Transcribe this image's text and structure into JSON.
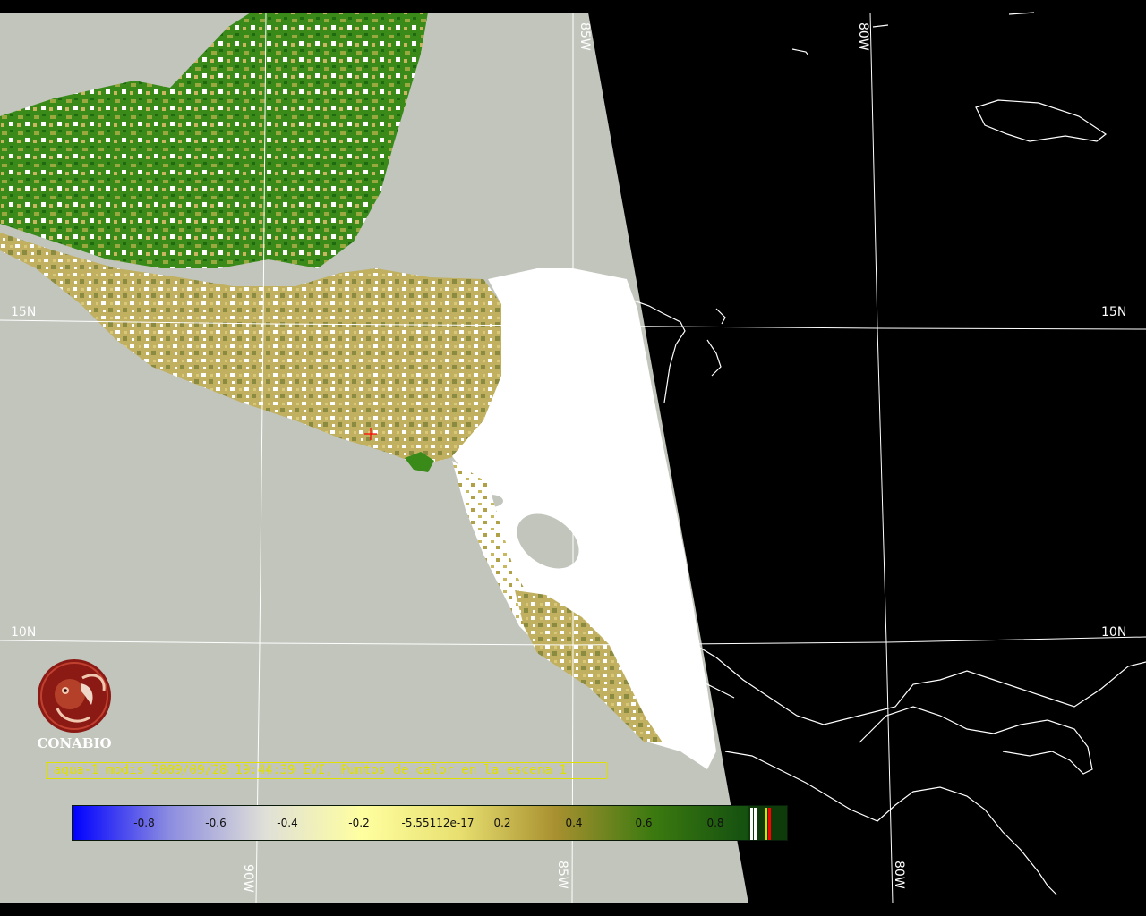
{
  "map": {
    "product_label": "aqua-1 modis 2009/09/28 19:44:39 EVI, Puntos de calor en la escena 1",
    "logo_text": "CONABIO",
    "grid_labels": {
      "lat_15n_left": "15N",
      "lat_15n_right": "15N",
      "lat_10n_left": "10N",
      "lat_10n_right": "10N",
      "lon_85w_top": "85W",
      "lon_80w_top": "80W",
      "lon_90w_bottom": "90W",
      "lon_85w_bottom": "85W",
      "lon_80w_bottom": "80W"
    },
    "colors": {
      "land_background": "#c1c5bc",
      "ocean_night": "#000000",
      "cloud": "#ffffff",
      "vegetation_dense": "#2a7a12",
      "vegetation_sparse": "#b8a040",
      "grid": "#ffffff",
      "label_text": "#e0e000"
    }
  },
  "colorbar": {
    "ticks": [
      "-0.8",
      "-0.6",
      "-0.4",
      "-0.2",
      "-5.55112e-17",
      "0.2",
      "0.4",
      "0.6",
      "0.8"
    ],
    "stops": [
      "#0000ff",
      "#8c8ce0",
      "#e0e0d8",
      "#ffffa0",
      "#e8e070",
      "#a89030",
      "#3c7a10",
      "#145010"
    ],
    "end_colors": [
      "#ffffff",
      "#ffffff",
      "#e0e000",
      "#ff0000"
    ]
  }
}
